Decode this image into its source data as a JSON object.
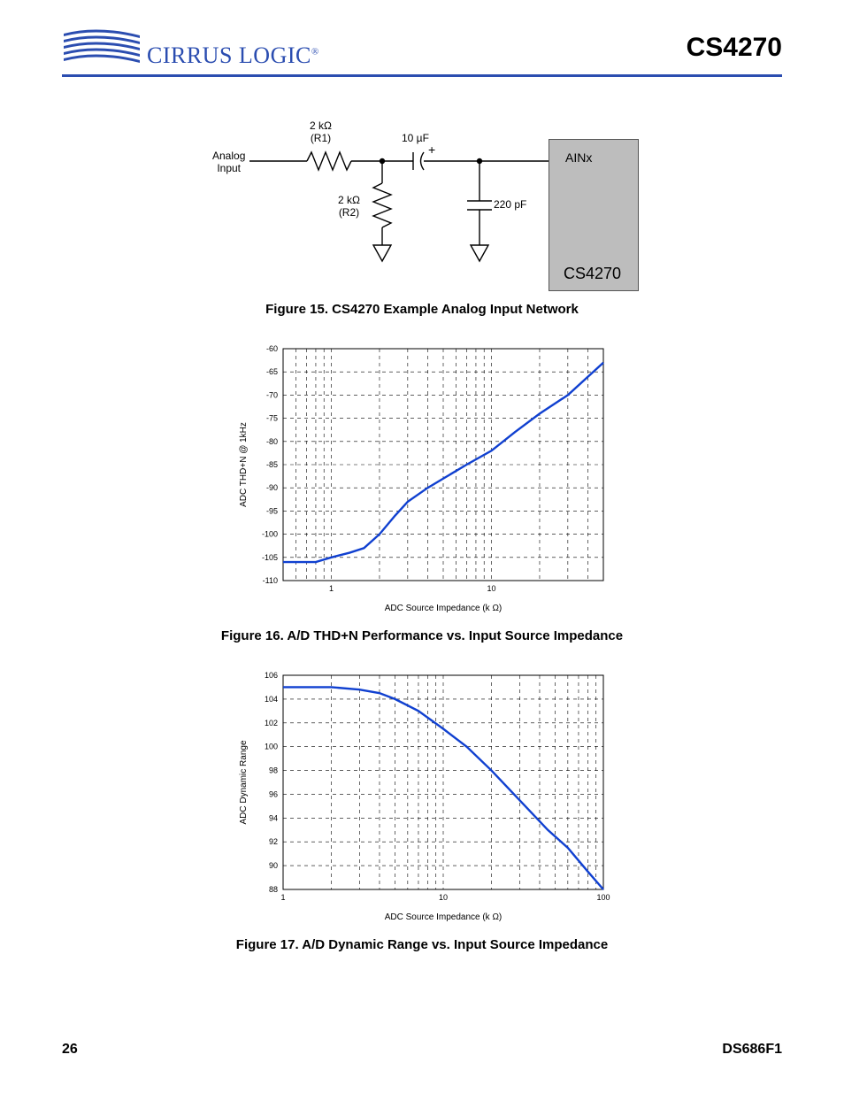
{
  "header": {
    "brand": "CIRRUS LOGIC",
    "part": "CS4270"
  },
  "footer": {
    "page": "26",
    "doc": "DS686F1"
  },
  "fig15": {
    "caption": "Figure 15.  CS4270 Example Analog Input Network",
    "labels": {
      "analog_input": "Analog\nInput",
      "r1": "2 kΩ\n(R1)",
      "r2": "2 kΩ\n(R2)",
      "c1": "10 µF",
      "c2": "220 pF",
      "ainx": "AINx",
      "chip": "CS4270",
      "plus": "+"
    }
  },
  "fig16": {
    "caption": "Figure 16.  A/D THD+N Performance vs. Input Source Impedance"
  },
  "fig17": {
    "caption": "Figure 17.  A/D Dynamic Range vs. Input Source Impedance"
  },
  "chart_data": [
    {
      "type": "line",
      "title": "A/D THD+N Performance vs. Input Source Impedance",
      "xlabel": "ADC Source Impedance (k Ω)",
      "ylabel": "ADC THD+N @ 1kHz",
      "x_scale": "log",
      "xlim": [
        0.5,
        50
      ],
      "ylim": [
        -110,
        -60
      ],
      "x_ticks": [
        1,
        10
      ],
      "y_ticks": [
        -110,
        -105,
        -100,
        -95,
        -90,
        -85,
        -80,
        -75,
        -70,
        -65,
        -60
      ],
      "series": [
        {
          "name": "THD+N",
          "x": [
            0.5,
            0.8,
            1.0,
            1.3,
            1.6,
            2.0,
            2.5,
            3.0,
            4.0,
            5.0,
            7.0,
            10,
            14,
            20,
            30,
            50
          ],
          "y": [
            -106,
            -106,
            -105,
            -104,
            -103,
            -100,
            -96,
            -93,
            -90,
            -88,
            -85,
            -82,
            -78,
            -74,
            -70,
            -63
          ]
        }
      ]
    },
    {
      "type": "line",
      "title": "A/D Dynamic Range vs. Input Source Impedance",
      "xlabel": "ADC Source Impedance (k Ω)",
      "ylabel": "ADC Dynamic Range",
      "x_scale": "log",
      "xlim": [
        1,
        100
      ],
      "ylim": [
        88,
        106
      ],
      "x_ticks": [
        1,
        10,
        100
      ],
      "y_ticks": [
        88,
        90,
        92,
        94,
        96,
        98,
        100,
        102,
        104,
        106
      ],
      "series": [
        {
          "name": "Dynamic Range",
          "x": [
            1,
            1.5,
            2,
            3,
            4,
            5,
            7,
            10,
            14,
            20,
            30,
            45,
            60,
            80,
            100
          ],
          "y": [
            105,
            105,
            105,
            104.8,
            104.5,
            104,
            103,
            101.5,
            100,
            98,
            95.5,
            93,
            91.5,
            89.5,
            88
          ]
        }
      ]
    }
  ]
}
